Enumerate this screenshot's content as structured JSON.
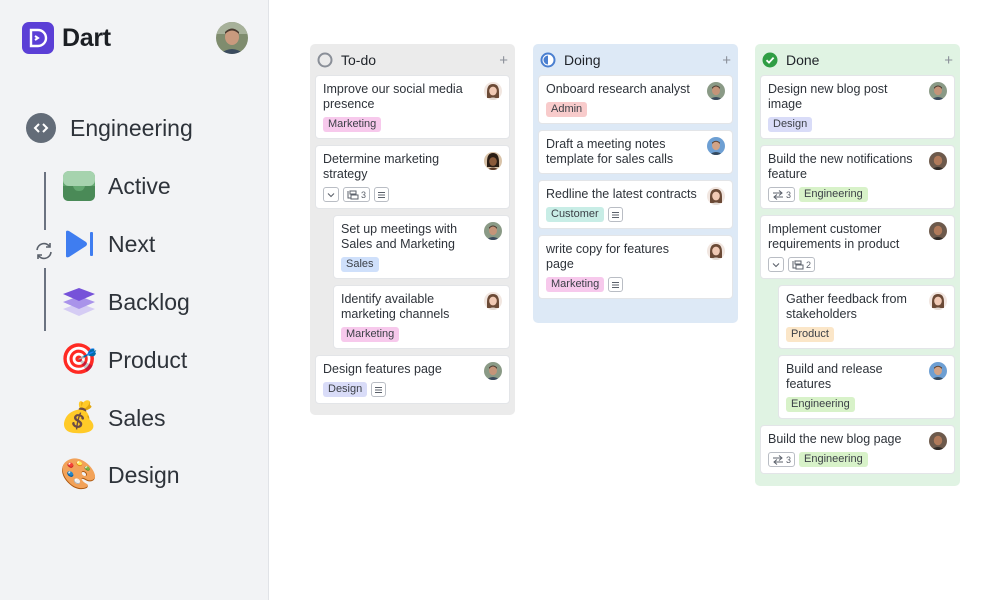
{
  "app": {
    "name": "Dart"
  },
  "sidebar": {
    "space": {
      "label": "Engineering"
    },
    "items": [
      {
        "label": "Active",
        "icon": "inbox-tray-icon"
      },
      {
        "label": "Next",
        "icon": "play-next-icon"
      },
      {
        "label": "Backlog",
        "icon": "layers-stack-icon"
      },
      {
        "label": "Product",
        "icon": "🎯"
      },
      {
        "label": "Sales",
        "icon": "💰"
      },
      {
        "label": "Design",
        "icon": "🎨"
      }
    ]
  },
  "board": {
    "columns": [
      {
        "title": "To-do",
        "add_label": "+"
      },
      {
        "title": "Doing",
        "add_label": "+"
      },
      {
        "title": "Done",
        "add_label": "+"
      }
    ],
    "todo": [
      {
        "title": "Improve our social media presence",
        "tag": "Marketing"
      },
      {
        "title": "Determine marketing strategy",
        "subtasks": "3"
      },
      {
        "title": "Set up meetings with Sales and Marketing",
        "tag": "Sales"
      },
      {
        "title": "Identify available marketing channels",
        "tag": "Marketing"
      },
      {
        "title": "Design features page",
        "tag": "Design"
      }
    ],
    "doing": [
      {
        "title": "Onboard research analyst",
        "tag": "Admin"
      },
      {
        "title": "Draft a meeting notes template for sales calls"
      },
      {
        "title": "Redline the latest contracts",
        "tag": "Customer"
      },
      {
        "title": "write copy for features page",
        "tag": "Marketing"
      }
    ],
    "done": [
      {
        "title": "Design new blog post image",
        "tag": "Design"
      },
      {
        "title": "Build the new notifications feature",
        "tag": "Engineering",
        "dependencies": "3"
      },
      {
        "title": "Implement customer requirements in product",
        "subtasks": "2"
      },
      {
        "title": "Gather feedback from stakeholders",
        "tag": "Product"
      },
      {
        "title": "Build and release features",
        "tag": "Engineering"
      },
      {
        "title": "Build the new blog page",
        "tag": "Engineering",
        "dependencies": "3"
      }
    ]
  },
  "colors": {
    "brand": "#5b3fd6",
    "todo_bg": "#ebebeb",
    "doing_bg": "#dde9f6",
    "done_bg": "#e0f3e3",
    "done_check": "#2f9e44",
    "doing_status": "#4a7fd0"
  }
}
